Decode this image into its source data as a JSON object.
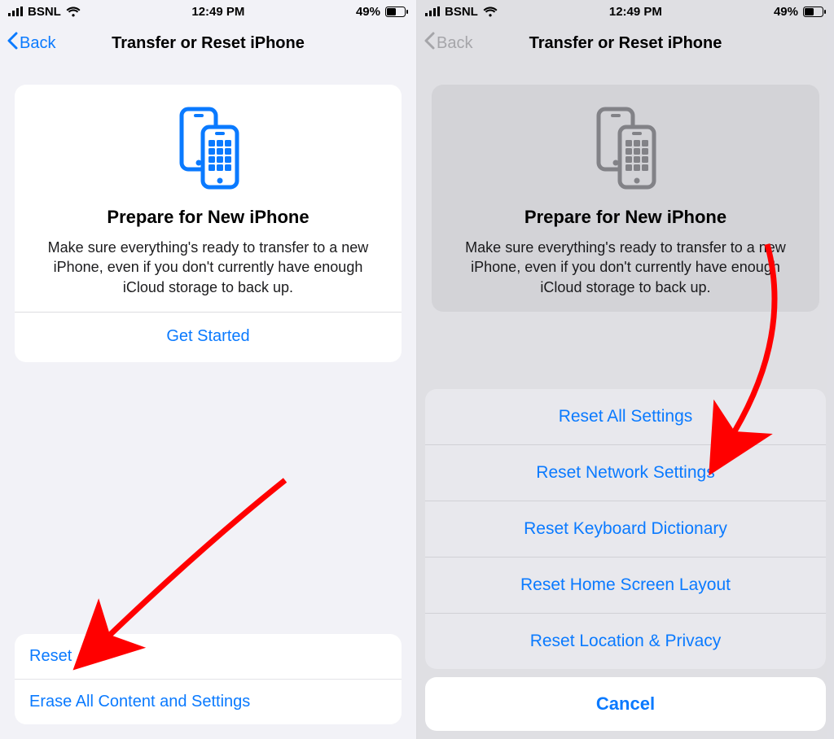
{
  "status": {
    "carrier": "BSNL",
    "time": "12:49 PM",
    "battery_pct": "49%"
  },
  "nav": {
    "back_label": "Back",
    "title": "Transfer or Reset iPhone"
  },
  "card": {
    "heading": "Prepare for New iPhone",
    "body": "Make sure everything's ready to transfer to a new iPhone, even if you don't currently have enough iCloud storage to back up.",
    "get_started": "Get Started"
  },
  "bottom": {
    "reset": "Reset",
    "erase": "Erase All Content and Settings"
  },
  "sheet": {
    "options": [
      "Reset All Settings",
      "Reset Network Settings",
      "Reset Keyboard Dictionary",
      "Reset Home Screen Layout",
      "Reset Location & Privacy"
    ],
    "cancel": "Cancel"
  },
  "colors": {
    "ios_blue": "#0a7aff",
    "arrow_red": "#ff0000"
  }
}
